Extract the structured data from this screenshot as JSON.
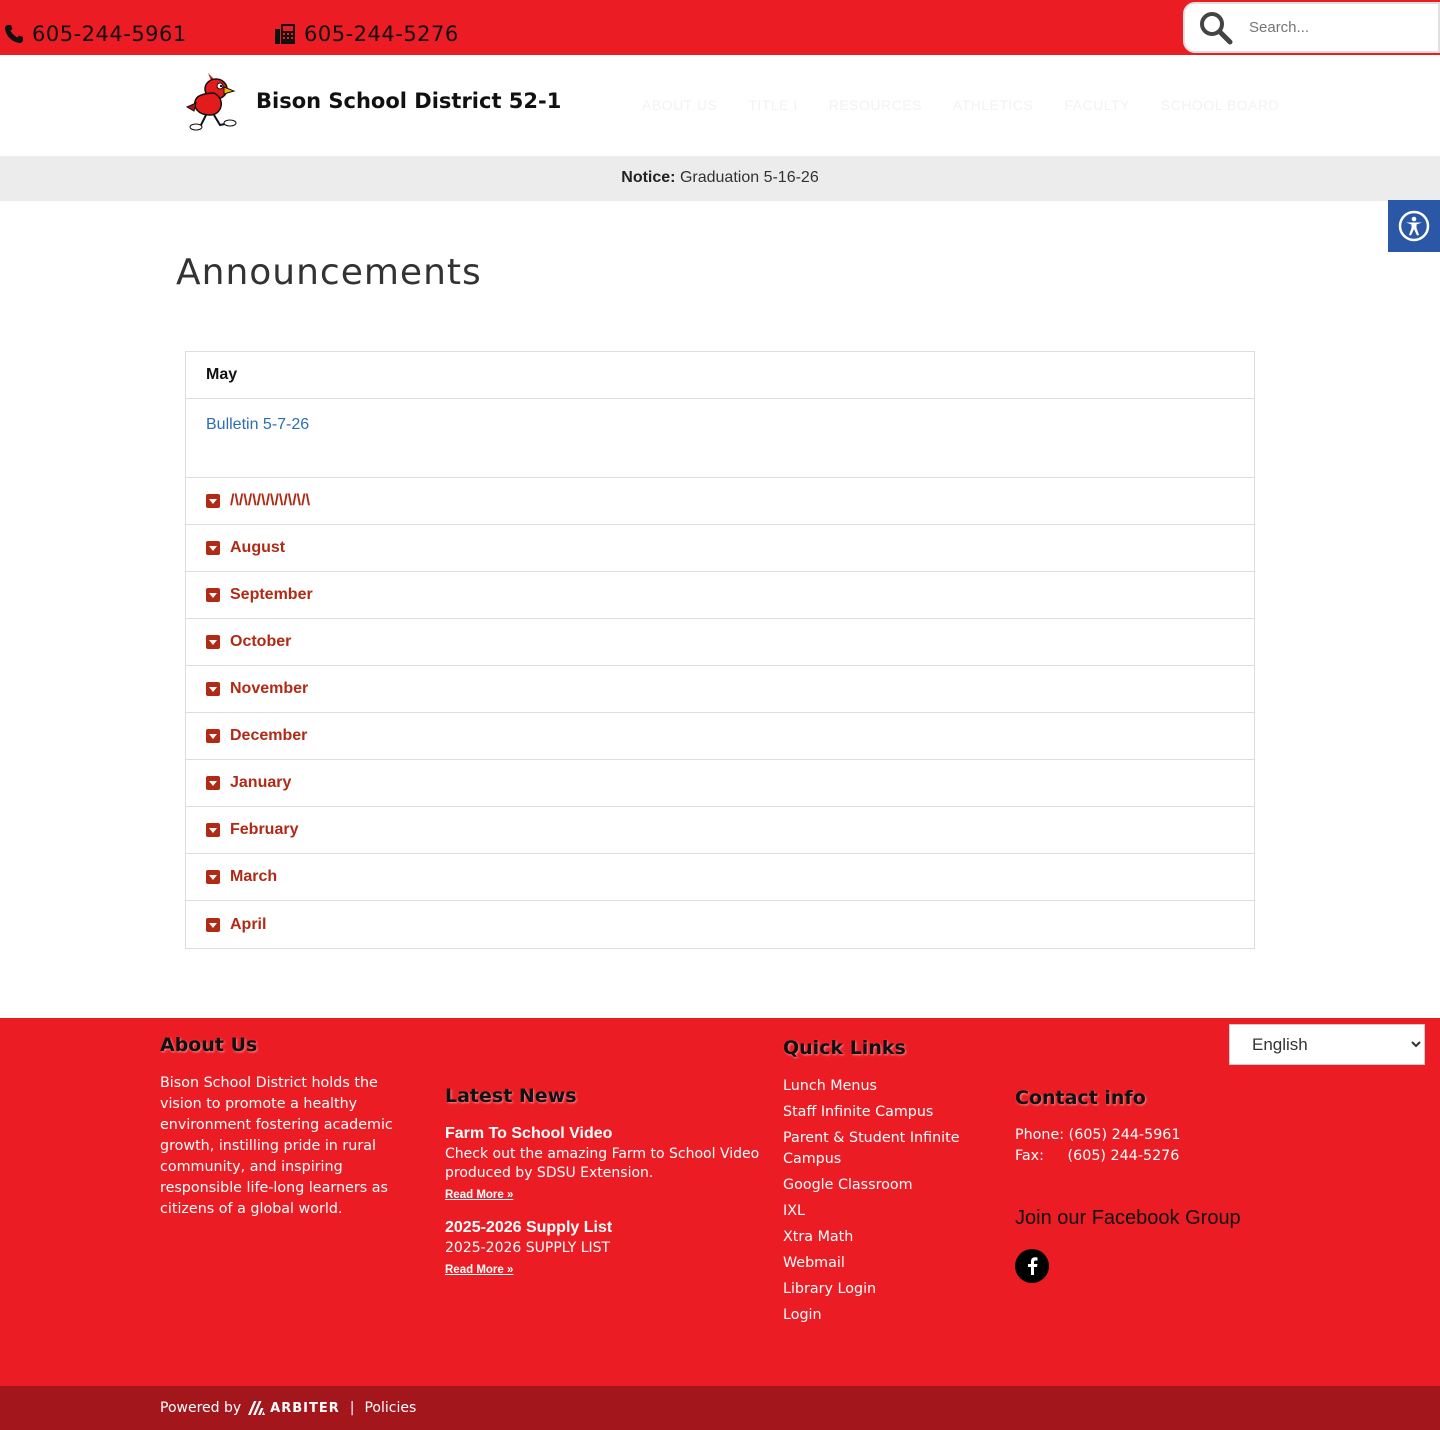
{
  "topbar": {
    "phone": "605-244-5961",
    "fax": "605-244-5276",
    "search_placeholder": "Search..."
  },
  "header": {
    "site_title": "Bison School District 52-1",
    "nav": [
      "ABOUT US",
      "TITLE I",
      "RESOURCES",
      "ATHLETICS",
      "FACULTY",
      "SCHOOL BOARD"
    ]
  },
  "notice": {
    "label": "Notice:",
    "text": "Graduation 5-16-26"
  },
  "main": {
    "title": "Announcements",
    "open_section": {
      "heading": "May",
      "link": "Bulletin 5-7-26"
    },
    "sections": [
      "/\\/\\/\\/\\/\\/\\/\\/\\/\\",
      "August",
      "September",
      "October",
      "November",
      "December",
      "January",
      "February",
      "March",
      "April"
    ]
  },
  "footer": {
    "about": {
      "heading": "About Us",
      "text": "Bison School District holds the vision to promote a healthy environment fostering academic growth, instilling pride in rural community, and inspiring responsible life-long learners as citizens of a global world."
    },
    "news": {
      "heading": "Latest News",
      "items": [
        {
          "title": "Farm To School Video",
          "desc": "Check out the amazing Farm to School Video produced by  SDSU Extension.",
          "read_more": "Read More »"
        },
        {
          "title": "2025-2026 Supply List",
          "desc": "2025-2026 SUPPLY LIST",
          "read_more": "Read More »"
        }
      ]
    },
    "quick_links": {
      "heading": "Quick Links",
      "items": [
        "Lunch Menus",
        "Staff Infinite Campus",
        "Parent & Student Infinite Campus",
        "Google Classroom",
        "IXL",
        "Xtra Math",
        "Webmail",
        "Library Login",
        "Login"
      ]
    },
    "contact": {
      "heading": "Contact info",
      "phone_label": "Phone:",
      "phone": "(605) 244-5961",
      "fax_label": "Fax:",
      "fax": "(605) 244-5276",
      "facebook_title": "Join our Facebook Group"
    },
    "language": "English"
  },
  "bottombar": {
    "powered_by": "Powered by",
    "brand": "ARBITER",
    "separator": "|",
    "policies": "Policies"
  },
  "colors": {
    "brand_red": "#ec1c24",
    "dark_red": "#a3161b",
    "accordion_red": "#b02a15",
    "link_blue": "#2a6fb5",
    "access_blue": "#2a58a6"
  }
}
